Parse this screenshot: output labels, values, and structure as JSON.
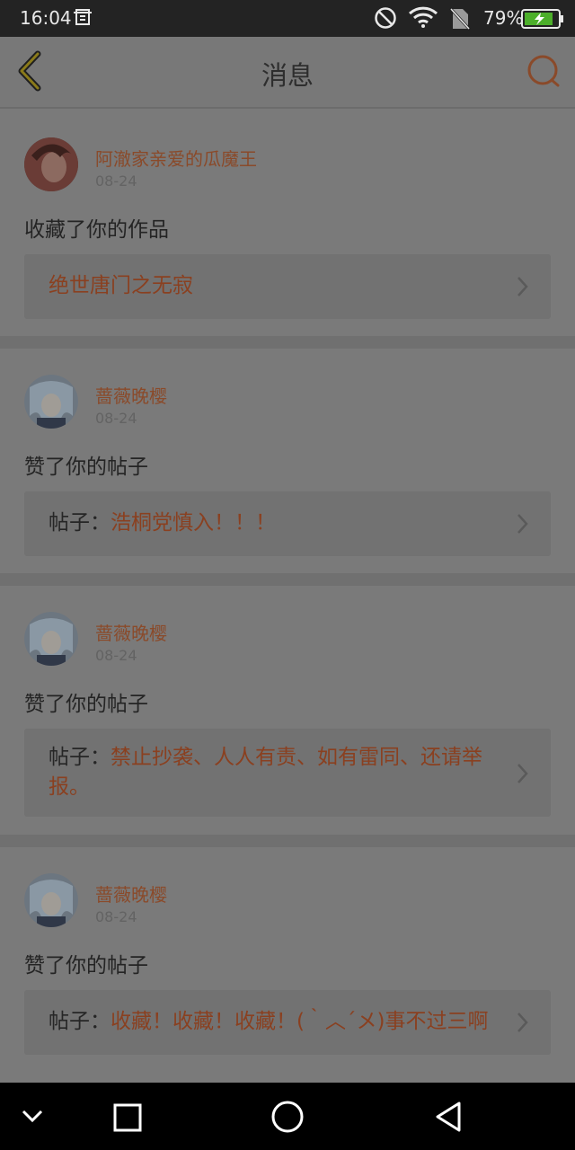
{
  "status_bar": {
    "time": "16:04",
    "battery": "79%"
  },
  "header": {
    "title": "消息"
  },
  "messages": [
    {
      "user": "阿澈家亲爱的瓜魔王",
      "date": "08-24",
      "action": "收藏了你的作品",
      "prefix": "",
      "content": "绝世唐门之无寂"
    },
    {
      "user": "蔷薇晚樱",
      "date": "08-24",
      "action": "赞了你的帖子",
      "prefix": "帖子：",
      "content": "浩桐党慎入！！！"
    },
    {
      "user": "蔷薇晚樱",
      "date": "08-24",
      "action": "赞了你的帖子",
      "prefix": "帖子：",
      "content": "禁止抄袭、人人有责、如有雷同、还请举报。"
    },
    {
      "user": "蔷薇晚樱",
      "date": "08-24",
      "action": "赞了你的帖子",
      "prefix": "帖子：",
      "content": "收藏！收藏！收藏！(｀︿´メ)事不过三啊"
    }
  ],
  "icons": {
    "back": "chevron-left-icon",
    "chat": "chat-bubble-icon",
    "nav": [
      "chevron-down-icon",
      "square-icon",
      "circle-icon",
      "triangle-back-icon"
    ]
  }
}
